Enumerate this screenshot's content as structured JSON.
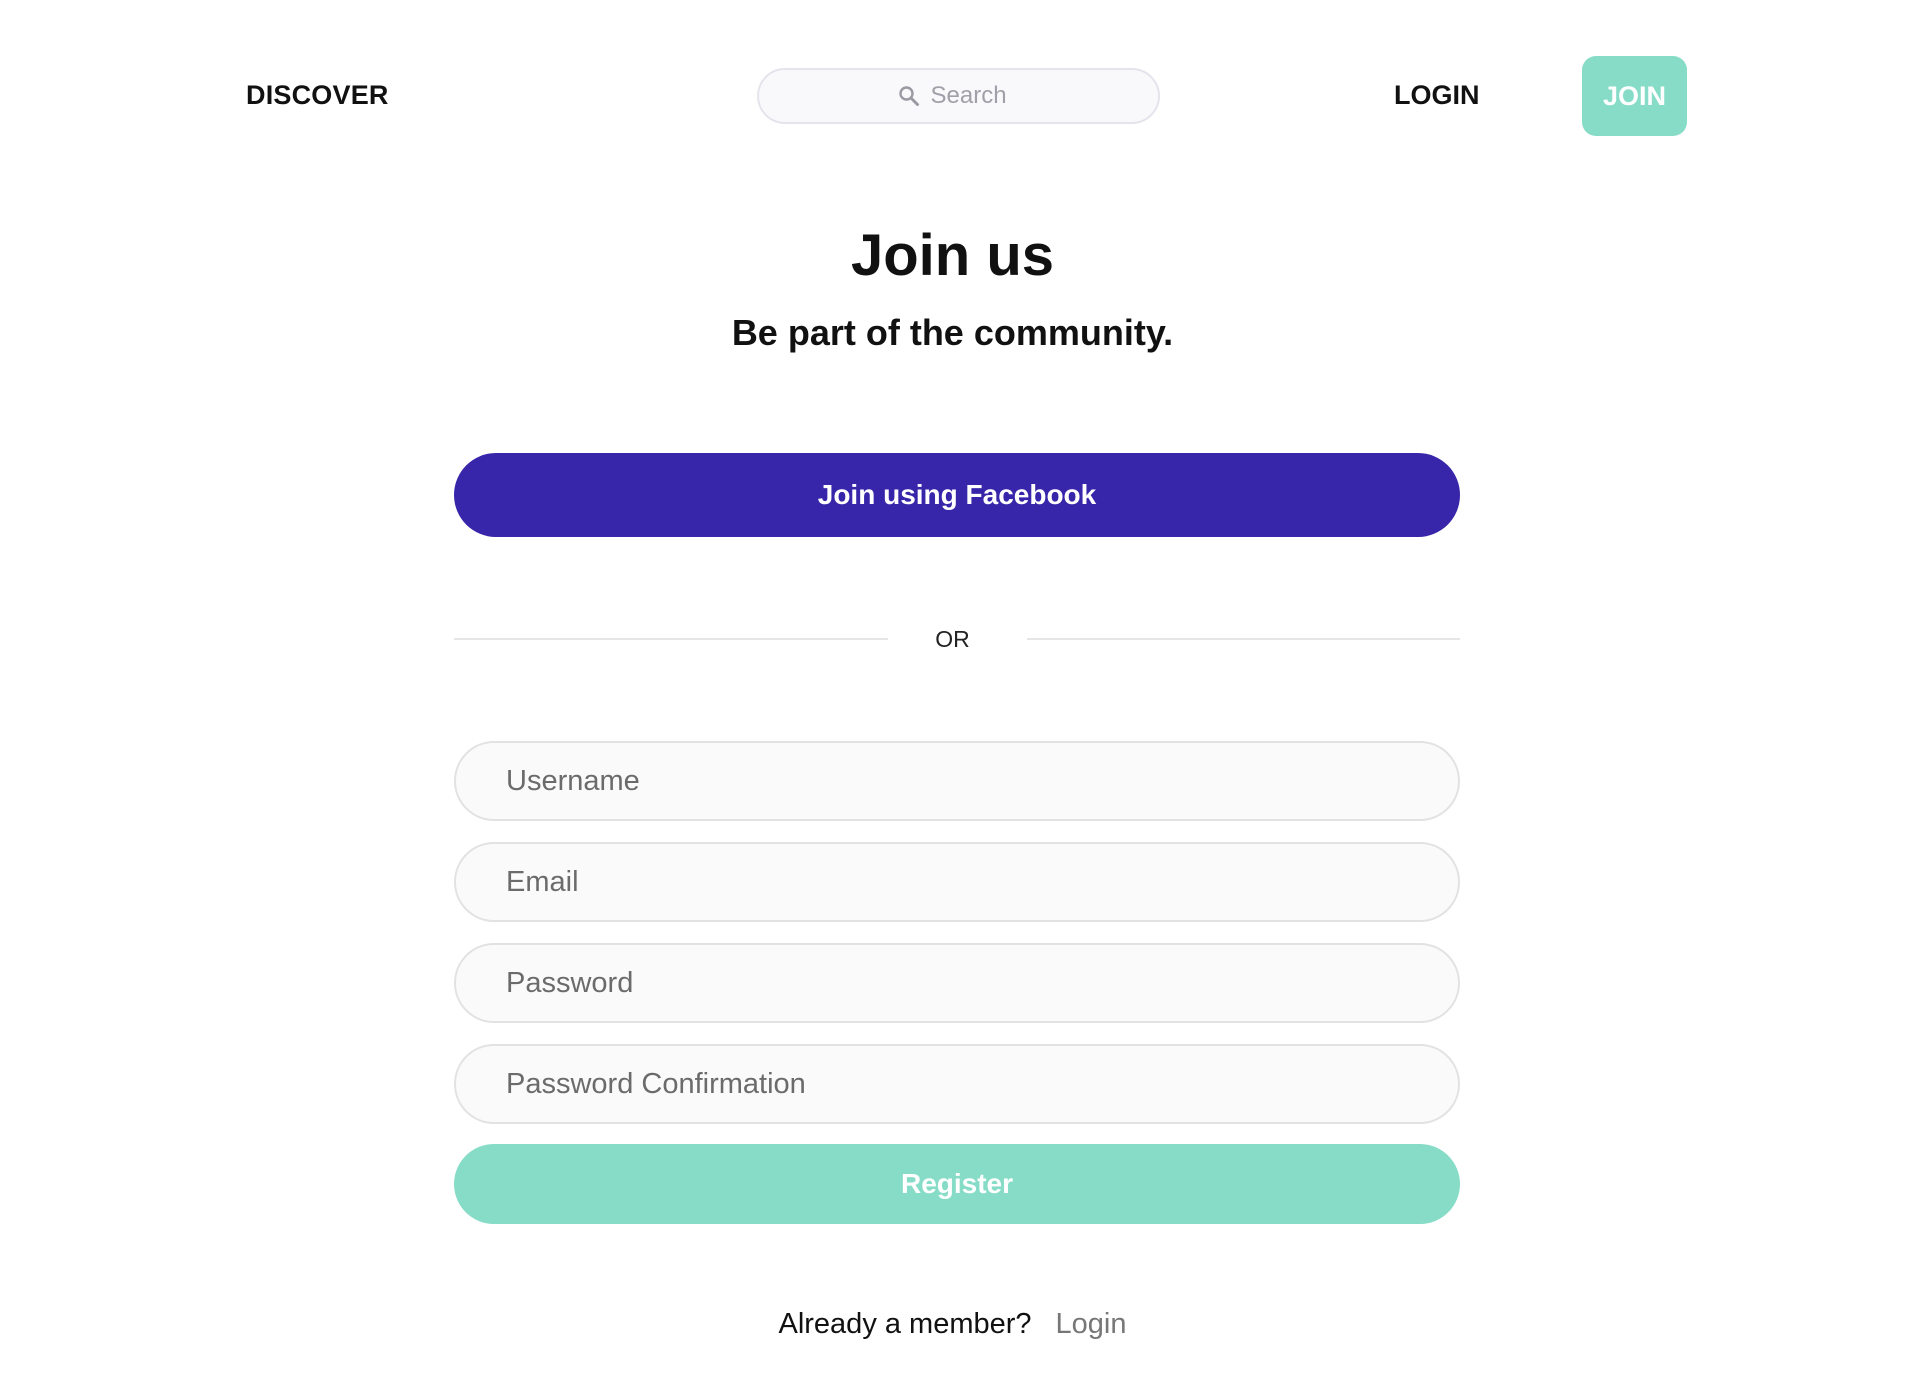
{
  "header": {
    "discover_label": "DISCOVER",
    "search": {
      "placeholder": "Search",
      "icon": "search-icon"
    },
    "login_label": "LOGIN",
    "join_label": "JOIN"
  },
  "hero": {
    "title": "Join us",
    "subtitle": "Be part of the community."
  },
  "social": {
    "facebook_label": "Join using Facebook"
  },
  "divider": {
    "label": "OR"
  },
  "form": {
    "username_placeholder": "Username",
    "email_placeholder": "Email",
    "password_placeholder": "Password",
    "password_confirmation_placeholder": "Password Confirmation",
    "register_label": "Register"
  },
  "footer": {
    "member_text": "Already a member?",
    "login_link": "Login"
  },
  "colors": {
    "accent_mint": "#86dcc6",
    "facebook_purple": "#3725aa",
    "text_dark": "#111111",
    "field_border": "#e2e2e2"
  }
}
